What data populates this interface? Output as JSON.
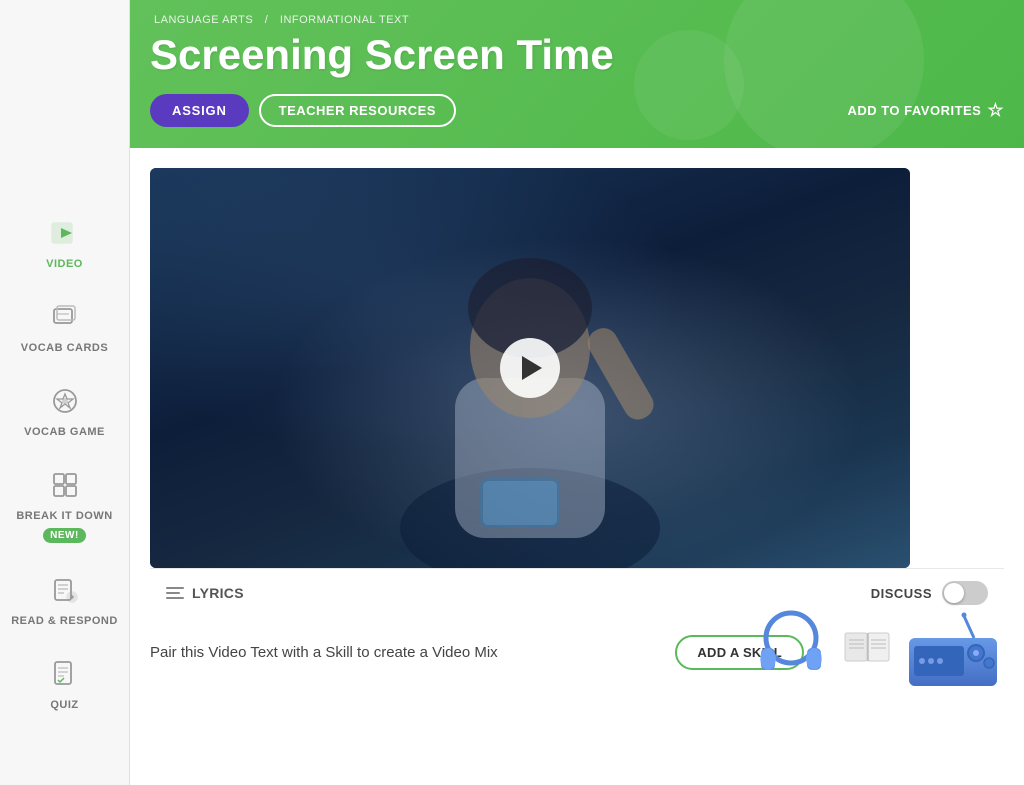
{
  "meta": {
    "colors": {
      "green": "#5cb85c",
      "purple": "#5a3bbf",
      "white": "#ffffff",
      "darkText": "#333333",
      "mutedText": "#777777"
    }
  },
  "breadcrumb": {
    "part1": "LANGUAGE ARTS",
    "separator1": "/",
    "part2": "INFORMATIONAL TEXT"
  },
  "header": {
    "title": "Screening Screen Time",
    "assign_label": "ASSIGN",
    "teacher_resources_label": "TEACHER RESOURCES",
    "add_favorites_label": "ADD TO FAVORITES"
  },
  "sidebar": {
    "items": [
      {
        "id": "video",
        "label": "VIDEO",
        "active": true
      },
      {
        "id": "vocab-cards",
        "label": "VOCAB CARDS",
        "active": false
      },
      {
        "id": "vocab-game",
        "label": "VOCAB GAME",
        "active": false
      },
      {
        "id": "break-it-down",
        "label": "BREAK IT DOWN",
        "active": false,
        "badge": "NEW!"
      },
      {
        "id": "read-respond",
        "label": "READ & RESPOND",
        "active": false
      },
      {
        "id": "quiz",
        "label": "QUIZ",
        "active": false
      }
    ]
  },
  "video": {
    "lyrics_label": "LYRICS",
    "discuss_label": "DISCUSS"
  },
  "promo": {
    "text": "Pair this Video Text with a Skill to create a Video Mix",
    "button_label": "ADD A SKILL"
  }
}
